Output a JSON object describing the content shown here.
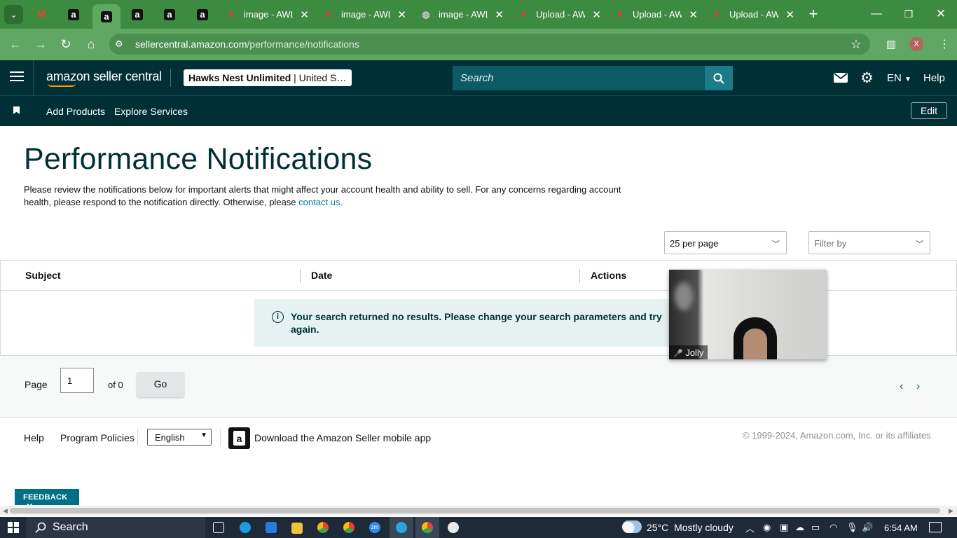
{
  "browser": {
    "tabs": [
      {
        "icon": "tab-list-icon"
      },
      {
        "icon": "gmail-icon"
      },
      {
        "icon": "amazon-icon"
      },
      {
        "icon": "amazon-icon",
        "active": true
      },
      {
        "icon": "amazon-icon"
      },
      {
        "icon": "amazon-icon"
      },
      {
        "icon": "amazon-icon"
      },
      {
        "icon": "awl-icon",
        "title": "image - AWL"
      },
      {
        "icon": "awl-icon",
        "title": "image - AWL"
      },
      {
        "icon": "globe-icon",
        "title": "image - AWL"
      },
      {
        "icon": "awl-icon",
        "title": "Upload - AW"
      },
      {
        "icon": "awl-icon",
        "title": "Upload - AW"
      },
      {
        "icon": "awl-icon",
        "title": "Upload - AW"
      }
    ],
    "new_tab": "+",
    "url_host": "sellercentral.amazon.com",
    "url_path": "/performance/notifications",
    "profile_initial": "X",
    "amazon_glyph": "a",
    "close_glyph": "✕"
  },
  "header": {
    "logo_text": "amazon seller central",
    "account_name": "Hawks Nest Unlimited",
    "account_region": " | United S…",
    "search_placeholder": "Search",
    "language": "EN",
    "help": "Help"
  },
  "subnav": {
    "items": [
      "Add Products",
      "Explore Services"
    ],
    "edit": "Edit"
  },
  "page": {
    "title": "Performance Notifications",
    "intro": "Please review the notifications below for important alerts that might affect your account health and ability to sell. For any concerns regarding account health, please respond to the notification directly. Otherwise, please ",
    "contact_link": "contact us.",
    "per_page": "25 per page",
    "filter_placeholder": "Filter by",
    "columns": [
      "Subject",
      "Date",
      "Actions"
    ],
    "empty_message": "Your search returned no results. Please change your search parameters and try again.",
    "pager": {
      "page_label": "Page",
      "page_value": "1",
      "of_label": "of 0",
      "go": "Go"
    }
  },
  "footer": {
    "help": "Help",
    "policies": "Program Policies",
    "language": "English",
    "app_link": "Download the Amazon Seller mobile app",
    "copyright": "© 1999-2024, Amazon.com, Inc. or its affiliates",
    "feedback": "FEEDBACK"
  },
  "video_overlay": {
    "participant": "Jolly"
  },
  "taskbar": {
    "search": "Search",
    "temperature": "25°C",
    "weather": "Mostly cloudy",
    "time": "6:54 AM",
    "zoom_label": "zm"
  },
  "colors": {
    "amazon_dark": "#002f36",
    "browser_green": "#5fa763",
    "link": "#008296",
    "taskbar": "#1f2a38"
  }
}
